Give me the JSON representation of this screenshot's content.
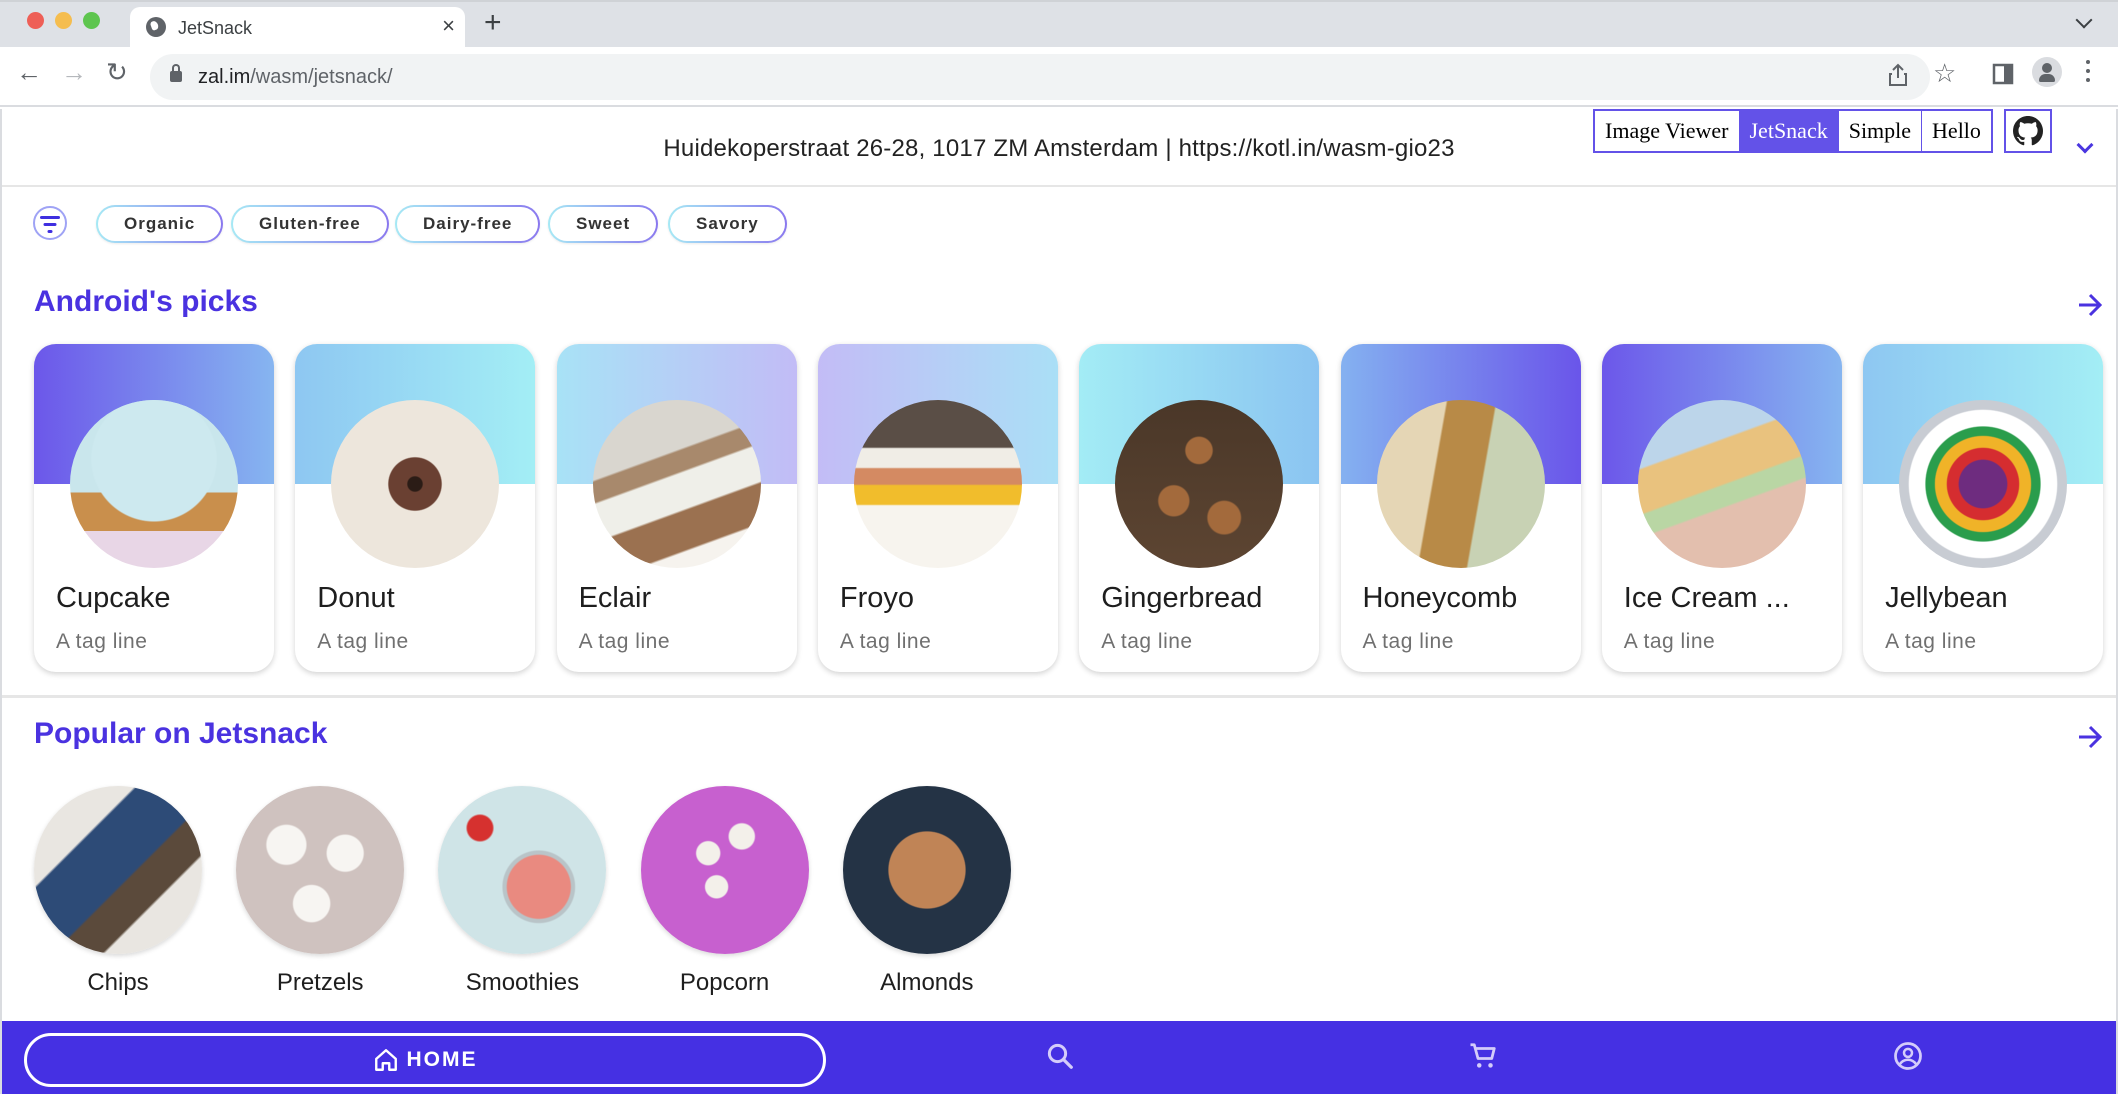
{
  "browser": {
    "tab_title": "JetSnack",
    "url_host": "zal.im",
    "url_path": "/wasm/jetsnack/",
    "new_tab_label": "+"
  },
  "app": {
    "address": "Huidekoperstraat 26-28, 1017 ZM Amsterdam | https://kotl.in/wasm-gio23",
    "demo_nav": [
      {
        "label": "Image Viewer",
        "active": false
      },
      {
        "label": "JetSnack",
        "active": true
      },
      {
        "label": "Simple",
        "active": false
      },
      {
        "label": "Hello",
        "active": false
      }
    ],
    "accent_color": "#4a32e0",
    "bottom_nav_color": "#4530e3"
  },
  "filters": [
    "Organic",
    "Gluten-free",
    "Dairy-free",
    "Sweet",
    "Savory"
  ],
  "androids_picks": {
    "title": "Android's picks",
    "items": [
      {
        "name": "Cupcake",
        "tagline": "A tag line",
        "gradient": [
          "#6c57ea",
          "#86b5f0"
        ]
      },
      {
        "name": "Donut",
        "tagline": "A tag line",
        "gradient": [
          "#8ec7f2",
          "#a3eef5"
        ]
      },
      {
        "name": "Eclair",
        "tagline": "A tag line",
        "gradient": [
          "#a8e2f6",
          "#c2bcf6"
        ]
      },
      {
        "name": "Froyo",
        "tagline": "A tag line",
        "gradient": [
          "#c3bcf6",
          "#aadff6"
        ]
      },
      {
        "name": "Gingerbread",
        "tagline": "A tag line",
        "gradient": [
          "#a3ecf5",
          "#8bc4f1"
        ]
      },
      {
        "name": "Honeycomb",
        "tagline": "A tag line",
        "gradient": [
          "#84b1f0",
          "#6a55ea"
        ]
      },
      {
        "name": "Ice Cream ...",
        "tagline": "A tag line",
        "gradient": [
          "#6c57ea",
          "#86b5f0"
        ]
      },
      {
        "name": "Jellybean",
        "tagline": "A tag line",
        "gradient": [
          "#8ec7f2",
          "#a3eef5"
        ]
      }
    ]
  },
  "popular": {
    "title": "Popular on Jetsnack",
    "items": [
      {
        "name": "Chips"
      },
      {
        "name": "Pretzels"
      },
      {
        "name": "Smoothies"
      },
      {
        "name": "Popcorn"
      },
      {
        "name": "Almonds"
      }
    ]
  },
  "bottom_nav": {
    "home_label": "HOME",
    "items": [
      "home-icon",
      "search-icon",
      "cart-icon",
      "profile-icon"
    ]
  }
}
